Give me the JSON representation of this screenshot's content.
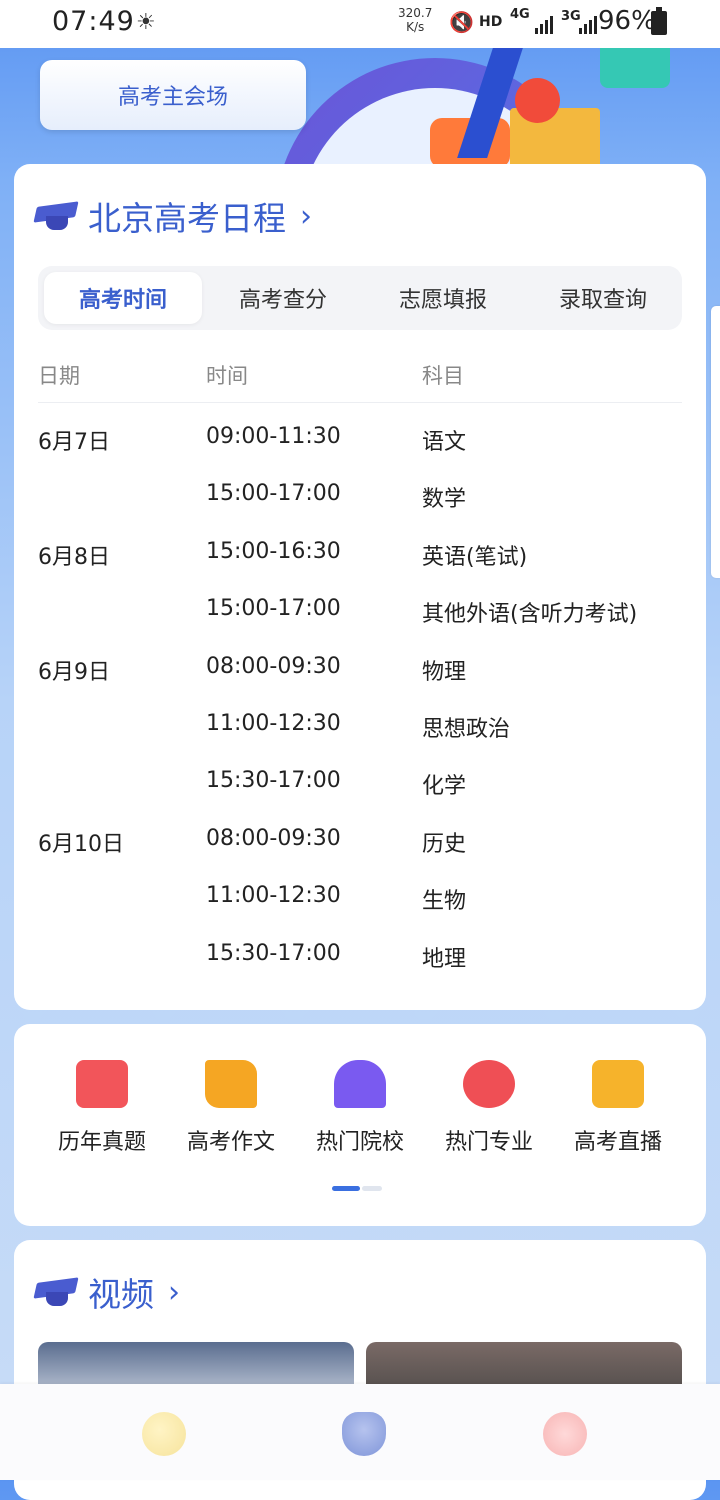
{
  "status_bar": {
    "time": "07:49",
    "weather_icon": "sun-haze-icon",
    "net_speed_value": "320.7",
    "net_speed_unit": "K/s",
    "hd": "HD",
    "net1": "4G",
    "net2": "3G",
    "battery_pct": "96%"
  },
  "banner": {
    "main_button": "高考主会场"
  },
  "schedule": {
    "title": "北京高考日程",
    "chevron": "›",
    "tabs": [
      {
        "label": "高考时间",
        "active": true
      },
      {
        "label": "高考查分",
        "active": false
      },
      {
        "label": "志愿填报",
        "active": false
      },
      {
        "label": "录取查询",
        "active": false
      }
    ],
    "columns": [
      "日期",
      "时间",
      "科目"
    ],
    "rows": [
      {
        "date": "6月7日",
        "time": "09:00-11:30",
        "subject": "语文"
      },
      {
        "date": "",
        "time": "15:00-17:00",
        "subject": "数学"
      },
      {
        "date": "6月8日",
        "time": "15:00-16:30",
        "subject": "英语(笔试)"
      },
      {
        "date": "",
        "time": "15:00-17:00",
        "subject": "其他外语(含听力考试)"
      },
      {
        "date": "6月9日",
        "time": "08:00-09:30",
        "subject": "物理"
      },
      {
        "date": "",
        "time": "11:00-12:30",
        "subject": "思想政治"
      },
      {
        "date": "",
        "time": "15:30-17:00",
        "subject": "化学"
      },
      {
        "date": "6月10日",
        "time": "08:00-09:30",
        "subject": "历史"
      },
      {
        "date": "",
        "time": "11:00-12:30",
        "subject": "生物"
      },
      {
        "date": "",
        "time": "15:30-17:00",
        "subject": "地理"
      }
    ]
  },
  "quick_links": [
    {
      "label": "历年真题",
      "icon": "book-icon",
      "color": "#f2555a"
    },
    {
      "label": "高考作文",
      "icon": "scroll-icon",
      "color": "#f5a623"
    },
    {
      "label": "热门院校",
      "icon": "university-icon",
      "color": "#7a5af0"
    },
    {
      "label": "热门专业",
      "icon": "award-ribbon-icon",
      "color": "#ef4f55"
    },
    {
      "label": "高考直播",
      "icon": "video-camera-icon",
      "color": "#f6b32b"
    }
  ],
  "video_section": {
    "title": "视频",
    "chevron": "›"
  },
  "bottom_nav": [
    {
      "icon": "moon-icon"
    },
    {
      "icon": "bag-icon"
    },
    {
      "icon": "paw-icon"
    }
  ],
  "colors": {
    "accent": "#3a5fcd",
    "page_bg_top": "#5b95f2",
    "page_bg_bottom": "#c8dcf7"
  }
}
